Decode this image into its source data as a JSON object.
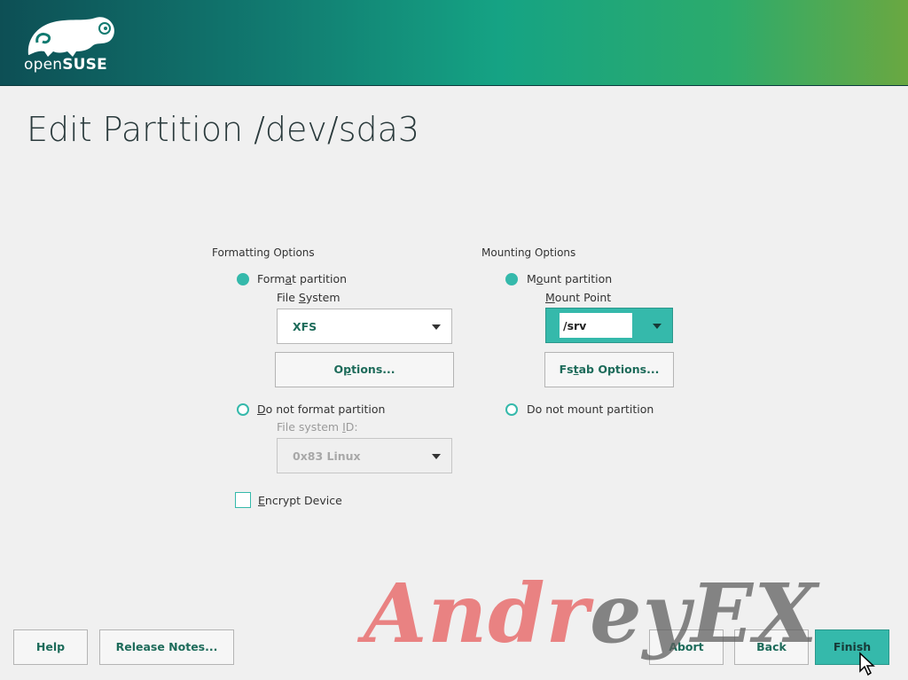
{
  "header": {
    "logo_text_light": "open",
    "logo_text_bold": "SUSE",
    "logo_icon": "chameleon-logo-icon",
    "colors": {
      "gradient_start": "#0d4f55",
      "gradient_mid": "#15a384",
      "gradient_end": "#6aa841"
    }
  },
  "page": {
    "title": "Edit Partition /dev/sda3"
  },
  "formatting": {
    "section_label": "Formatting Options",
    "format_partition": {
      "label_pre": "Form",
      "label_u": "a",
      "label_post": "t partition",
      "selected": true
    },
    "filesystem_label": {
      "pre": "File ",
      "u": "S",
      "post": "ystem"
    },
    "filesystem_value": "XFS",
    "options_button": {
      "pre": "O",
      "u": "p",
      "post": "tions..."
    },
    "do_not_format": {
      "label_u": "D",
      "label_post": "o not format partition",
      "selected": false
    },
    "filesystem_id_label": {
      "pre": "File system ",
      "u": "I",
      "post": "D:"
    },
    "filesystem_id_value": "0x83 Linux",
    "encrypt_device": {
      "label_u": "E",
      "label_post": "ncrypt Device",
      "checked": false
    }
  },
  "mounting": {
    "section_label": "Mounting Options",
    "mount_partition": {
      "label_pre": "M",
      "label_u": "o",
      "label_post": "unt partition",
      "selected": true
    },
    "mount_point_label": {
      "u": "M",
      "post": "ount Point"
    },
    "mount_point_value": "/srv",
    "fstab_button": {
      "pre": "Fs",
      "u": "t",
      "post": "ab Options..."
    },
    "do_not_mount": {
      "label": "Do not mount partition",
      "selected": false
    }
  },
  "footer": {
    "help_label": "Help",
    "release_notes_label": "Release Notes...",
    "abort_label": "Abort",
    "back_label": "Back",
    "finish_label": "Finish"
  },
  "watermark": {
    "text_red": "Andr",
    "text_gray": "eyEX"
  },
  "colors": {
    "accent": "#35b9ab",
    "button_text": "#1d6b5a",
    "background": "#f0f0f0"
  }
}
